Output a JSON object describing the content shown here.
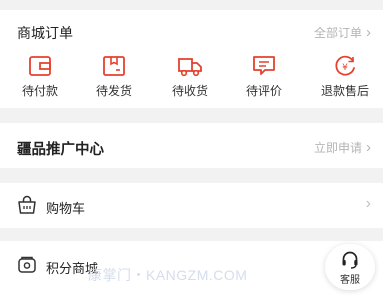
{
  "orders": {
    "title": "商城订单",
    "all_label": "全部订单",
    "items": [
      {
        "label": "待付款",
        "icon": "wallet-icon"
      },
      {
        "label": "待发货",
        "icon": "package-icon"
      },
      {
        "label": "待收货",
        "icon": "truck-icon"
      },
      {
        "label": "待评价",
        "icon": "comment-icon"
      },
      {
        "label": "退款售后",
        "icon": "refund-icon"
      }
    ]
  },
  "promo": {
    "title": "疆品推广中心",
    "apply_label": "立即申请"
  },
  "cart": {
    "label": "购物车",
    "icon": "cart-icon"
  },
  "points": {
    "label": "积分商城",
    "icon": "points-mall-icon"
  },
  "watermark": "康掌门・KANGZM.COM",
  "service": {
    "label": "客服",
    "icon": "headset-icon"
  },
  "colors": {
    "accent": "#e5412d",
    "background": "#f2f2f2",
    "card": "#ffffff",
    "muted_text": "#b5b5b5"
  }
}
